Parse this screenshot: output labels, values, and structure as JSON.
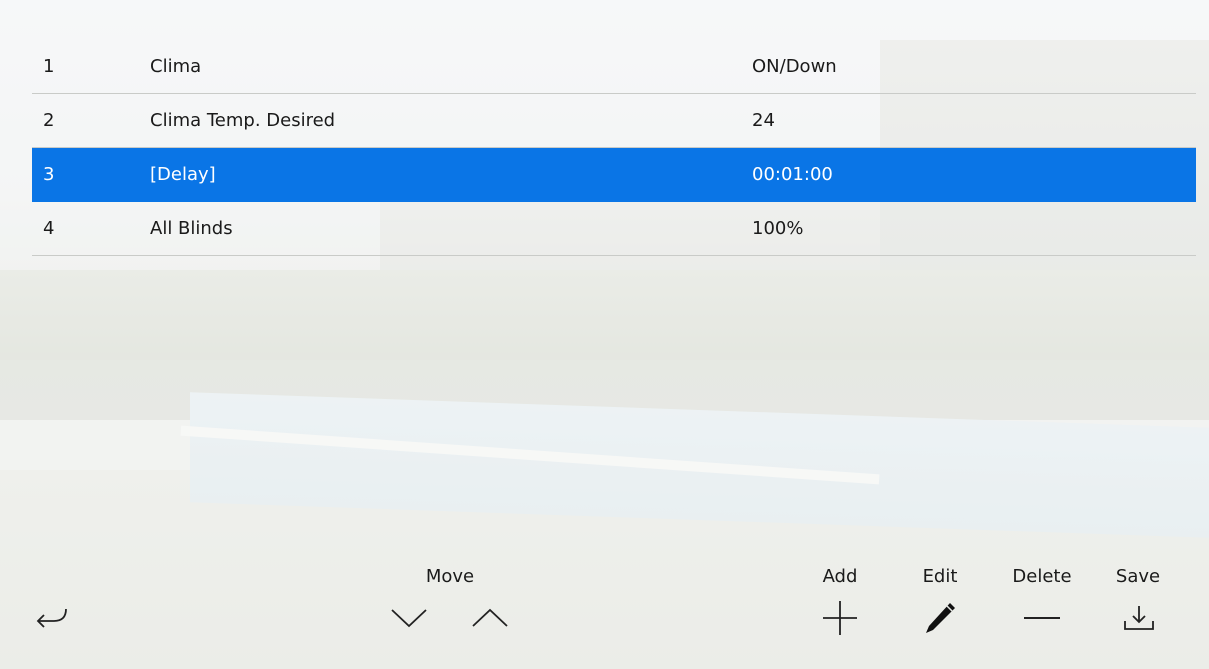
{
  "table": {
    "rows": [
      {
        "num": "1",
        "name": "Clima",
        "value": "ON/Down",
        "selected": false
      },
      {
        "num": "2",
        "name": "Clima Temp. Desired",
        "value": "24",
        "selected": false
      },
      {
        "num": "3",
        "name": "[Delay]",
        "value": "00:01:00",
        "selected": true
      },
      {
        "num": "4",
        "name": "All Blinds",
        "value": "100%",
        "selected": false
      }
    ]
  },
  "toolbar": {
    "move_label": "Move",
    "add_label": "Add",
    "edit_label": "Edit",
    "delete_label": "Delete",
    "save_label": "Save",
    "icons": {
      "back": "return-arrow-icon",
      "move_down": "chevron-down-icon",
      "move_up": "chevron-up-icon",
      "add": "plus-icon",
      "edit": "pencil-icon",
      "delete": "minus-icon",
      "save": "download-icon"
    }
  },
  "colors": {
    "selected_row": "#0a75e6",
    "selected_text": "#ffffff",
    "text": "#1a1a1a"
  }
}
